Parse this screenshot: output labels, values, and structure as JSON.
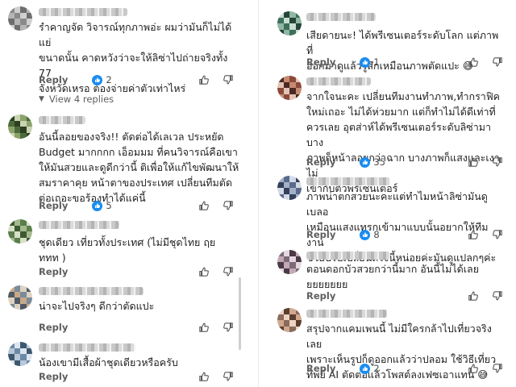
{
  "colors": {
    "like_badge": "#1a8cf0",
    "text": "#1f1f1f",
    "meta": "#5e5e5e"
  },
  "icons": {
    "like_badge": "thumbs-up-icon",
    "upvote": "thumbs-up-outline-icon",
    "downvote": "thumbs-down-outline-icon",
    "expand": "chevron-down-icon"
  },
  "left_comments": [
    {
      "text": "รำคาญจัด วิจารณ์ทุกภาพอ่ะ ผมว่ามันก็ไม่ได้แย่\nขนาดนั้น คาดหวังว่าจะให้ลิซ่าไปถ่ายจริงทั้ง 77\nจังหวัดเหรอ ต้องจ่ายค่าตัวเท่าไหร่",
      "reply_label": "Reply",
      "likes": "2",
      "view_replies": "View 4 replies"
    },
    {
      "text": "อันนี้ลอยของจริง!! ตัดต่อได้เลเวล ประหยัด\nBudget มากกกก เอ็อมมม ที่คนวิจารณ์คือเขา\nให้มันสวยและดูดีกว่านี้ ติเพื่อให้แก้ไขพัฒนาให้\nสมราคาคุย หน้าตาของประเทศ เปลี่ยนทีมตัด\nต่อเถอะขอร้องทำได้แค่นี้",
      "reply_label": "Reply",
      "likes": "5"
    },
    {
      "text": "ชุดเดียว เที่ยวทั้งประเทศ (ไม่มีชุดไทย ฤย\nททท )",
      "reply_label": "Reply"
    },
    {
      "text": "น่าจะไปจริงๆ ดีกว่าตัดแปะ",
      "reply_label": "Reply"
    },
    {
      "text": "น้องเขามีเสื้อผ้าชุดเดียวหรือครับ",
      "reply_label": "Reply"
    }
  ],
  "right_comments": [
    {
      "text": "เสียดายนะ! ได้พรีเซนเตอร์ระดับโลก แต่ภาพที่\nออกมาดูแล้วรู้สึกเหมือนภาพตัดแปะ 😅",
      "reply_label": "Reply",
      "likes": "1"
    },
    {
      "text": "จากใจนะคะ เปลี่ยนทีมงานทำภาพ,ทำกราฟิค\nใหม่เถอะ ไม่ได้ห่วยมาก แต่ก็ทำไม่ได้ดีเท่าที่\nควรเลย อุตส่าห์ได้พรีเซนเตอร์ระดับลิซ่ามา บาง\nภาพก็หน้าลอยกว่าฉาก บางภาพก็แสงและเงาไม่\nเข้ากับตัวพรีเซนเตอร์",
      "reply_label": "Reply",
      "likes": "35"
    },
    {
      "text": "ภาพน่าตกสวยนะคะแต่ทำไมหน้าลิซ่ามันดูเบลอ\nเหมือนแสงแทรกเข้ามาแบบนั้นอยากให้ทีมงาน\nช่วยปรับเปลี่ยนตรงนี้หน่อยค่ะมันดูแปลกๆค่ะ",
      "reply_label": "Reply",
      "likes": "8"
    },
    {
      "text": "ตอนดอกบัวสวยกว่านี้มาก อันนี้ไม่ได้เลย\nยยยยยยย",
      "reply_label": "Reply"
    },
    {
      "text": "สรุปจากแคมเพนนี้ ไม่มีใครกล้าไปเที่ยวจริงเลย\nเพราะเห็นรูปก็ดูออกแล้วว่าปลอม ใช้วิธีเที่ยว\nทิพย์ AI ตัดต่อแล้วโพสต์ลงเฟซเอาแทน 😅",
      "reply_label": "Reply",
      "likes": "2"
    }
  ]
}
